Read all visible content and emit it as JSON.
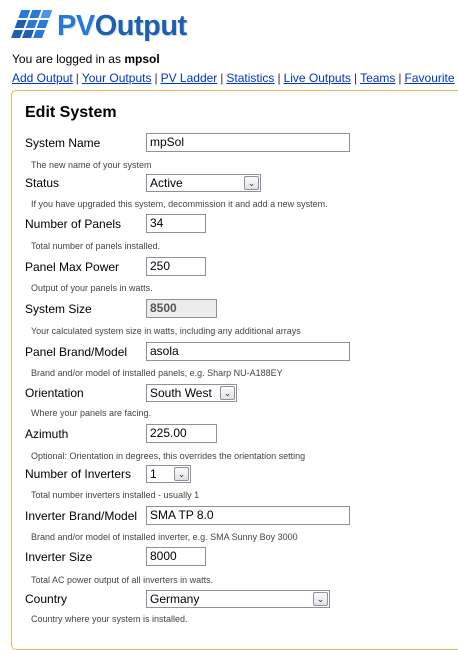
{
  "app": {
    "logo_text_pv": "PV",
    "logo_text_rest": "Output",
    "brand_color": "#2b6fc4"
  },
  "login": {
    "prefix": "You are logged in as",
    "username": "mpsol"
  },
  "nav": {
    "items": [
      {
        "label": "Add Output"
      },
      {
        "label": "Your Outputs"
      },
      {
        "label": "PV Ladder"
      },
      {
        "label": "Statistics"
      },
      {
        "label": "Live Outputs"
      },
      {
        "label": "Teams"
      },
      {
        "label": "Favourite"
      }
    ],
    "separator": "|"
  },
  "panel": {
    "title": "Edit System",
    "border_color": "#f0b357"
  },
  "fields": {
    "system_name": {
      "label": "System Name",
      "value": "mpSol",
      "hint": "The new name of your system"
    },
    "status": {
      "label": "Status",
      "value": "Active",
      "hint": "If you have upgraded this system, decommission it and add a new system."
    },
    "num_panels": {
      "label": "Number of Panels",
      "value": "34",
      "hint": "Total number of panels installed."
    },
    "panel_max_power": {
      "label": "Panel Max Power",
      "value": "250",
      "hint": "Output of your panels in watts."
    },
    "system_size": {
      "label": "System Size",
      "value": "8500",
      "hint": "Your calculated system size in watts, including any additional arrays"
    },
    "panel_brand": {
      "label": "Panel Brand/Model",
      "value": "asola",
      "hint": "Brand and/or model of installed panels, e.g. Sharp NU-A188EY"
    },
    "orientation": {
      "label": "Orientation",
      "value": "South West",
      "hint": "Where your panels are facing."
    },
    "azimuth": {
      "label": "Azimuth",
      "value": "225.00",
      "hint": "Optional: Orientation in degrees, this overrides the orientation setting"
    },
    "num_inverters": {
      "label": "Number of Inverters",
      "value": "1",
      "hint": "Total number inverters installed - usually 1"
    },
    "inverter_brand": {
      "label": "Inverter Brand/Model",
      "value": "SMA TP 8.0",
      "hint": "Brand and/or model of installed inverter, e.g. SMA Sunny Boy 3000"
    },
    "inverter_size": {
      "label": "Inverter Size",
      "value": "8000",
      "hint": "Total AC power output of all inverters in watts."
    },
    "country": {
      "label": "Country",
      "value": "Germany",
      "hint": "Country where your system is installed."
    }
  }
}
